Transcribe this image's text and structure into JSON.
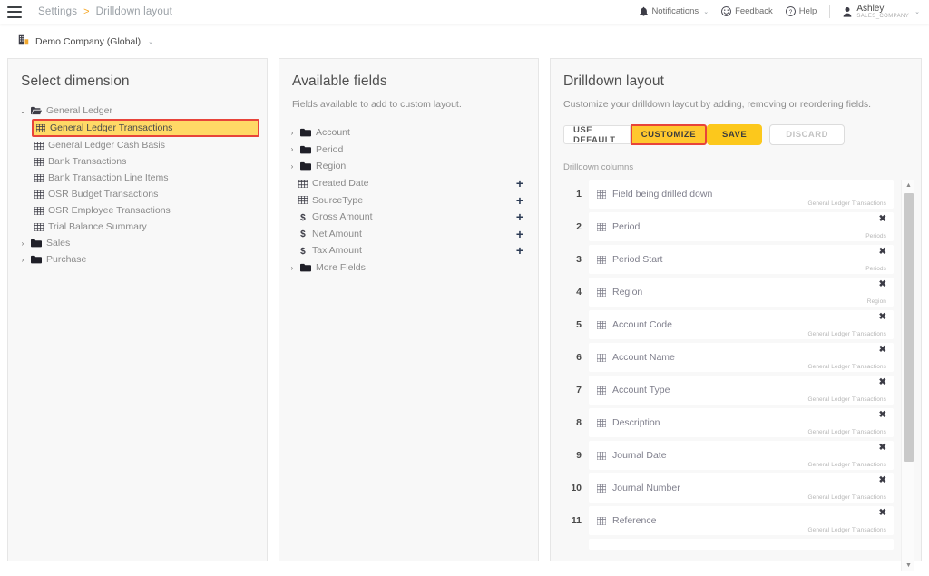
{
  "topbar": {
    "menu_icon": "hamburger-icon",
    "breadcrumb": {
      "root": "Settings",
      "separator": ">",
      "current": "Drilldown layout"
    },
    "notifications": {
      "label": "Notifications",
      "icon": "bell-icon",
      "caret": "⌄"
    },
    "feedback": {
      "label": "Feedback",
      "icon": "smiley-icon"
    },
    "help": {
      "label": "Help",
      "icon": "question-circle-icon"
    },
    "user": {
      "name": "Ashley",
      "org": "SALES_COMPANY",
      "icon": "person-icon",
      "caret": "⌄"
    }
  },
  "company": {
    "name": "Demo Company (Global)",
    "icon": "building-icon",
    "caret": "⌄"
  },
  "dimension_panel": {
    "title": "Select dimension",
    "tree": [
      {
        "label": "General Ledger",
        "type": "folder",
        "expanded": true,
        "depth": 0,
        "chevron": "⌄",
        "highlight": false
      },
      {
        "label": "General Ledger Transactions",
        "type": "grid",
        "depth": 1,
        "highlight": true
      },
      {
        "label": "General Ledger Cash Basis",
        "type": "grid",
        "depth": 1,
        "highlight": false
      },
      {
        "label": "Bank Transactions",
        "type": "grid",
        "depth": 1,
        "highlight": false
      },
      {
        "label": "Bank Transaction Line Items",
        "type": "grid",
        "depth": 1,
        "highlight": false
      },
      {
        "label": "OSR Budget Transactions",
        "type": "grid",
        "depth": 1,
        "highlight": false
      },
      {
        "label": "OSR Employee Transactions",
        "type": "grid",
        "depth": 1,
        "highlight": false
      },
      {
        "label": "Trial Balance Summary",
        "type": "grid",
        "depth": 1,
        "highlight": false
      },
      {
        "label": "Sales",
        "type": "folder",
        "expanded": false,
        "depth": 0,
        "chevron": "›",
        "highlight": false
      },
      {
        "label": "Purchase",
        "type": "folder",
        "expanded": false,
        "depth": 0,
        "chevron": "›",
        "highlight": false
      }
    ]
  },
  "fields_panel": {
    "title": "Available fields",
    "subtitle": "Fields available to add to custom layout.",
    "add_glyph": "+",
    "items": [
      {
        "label": "Account",
        "type": "folder",
        "chevron": "›",
        "add": false
      },
      {
        "label": "Period",
        "type": "folder",
        "chevron": "›",
        "add": false
      },
      {
        "label": "Region",
        "type": "folder",
        "chevron": "›",
        "add": false
      },
      {
        "label": "Created Date",
        "type": "grid",
        "add": true
      },
      {
        "label": "SourceType",
        "type": "grid",
        "add": true
      },
      {
        "label": "Gross Amount",
        "type": "currency",
        "add": true
      },
      {
        "label": "Net Amount",
        "type": "currency",
        "add": true
      },
      {
        "label": "Tax Amount",
        "type": "currency",
        "add": true
      },
      {
        "label": "More Fields",
        "type": "folder",
        "chevron": "›",
        "add": false
      }
    ]
  },
  "layout_panel": {
    "title": "Drilldown layout",
    "subtitle": "Customize your drilldown layout by adding, removing or reordering fields.",
    "mode_buttons": {
      "default_label": "USE DEFAULT",
      "customize_label": "CUSTOMIZE",
      "active": "CUSTOMIZE"
    },
    "save_label": "SAVE",
    "discard_label": "DISCARD",
    "discard_disabled": true,
    "columns_label": "Drilldown columns",
    "remove_glyph": "✖",
    "scroll_up_glyph": "▲",
    "scroll_down_glyph": "▼",
    "columns": [
      {
        "num": "1",
        "name": "Field being drilled down",
        "source": "General Ledger Transactions",
        "removable": false
      },
      {
        "num": "2",
        "name": "Period",
        "source": "Periods",
        "removable": true
      },
      {
        "num": "3",
        "name": "Period Start",
        "source": "Periods",
        "removable": true
      },
      {
        "num": "4",
        "name": "Region",
        "source": "Region",
        "removable": true
      },
      {
        "num": "5",
        "name": "Account Code",
        "source": "General Ledger Transactions",
        "removable": true
      },
      {
        "num": "6",
        "name": "Account Name",
        "source": "General Ledger Transactions",
        "removable": true
      },
      {
        "num": "7",
        "name": "Account Type",
        "source": "General Ledger Transactions",
        "removable": true
      },
      {
        "num": "8",
        "name": "Description",
        "source": "General Ledger Transactions",
        "removable": true
      },
      {
        "num": "9",
        "name": "Journal Date",
        "source": "General Ledger Transactions",
        "removable": true
      },
      {
        "num": "10",
        "name": "Journal Number",
        "source": "General Ledger Transactions",
        "removable": true
      },
      {
        "num": "11",
        "name": "Reference",
        "source": "General Ledger Transactions",
        "removable": true
      }
    ]
  },
  "colors": {
    "accent_yellow": "#fcc81c",
    "highlight_yellow": "#ffd966",
    "annotation_red": "#e8443a",
    "panel_bg": "#f8f8f8",
    "breadcrumb_sep": "#f5a623"
  }
}
